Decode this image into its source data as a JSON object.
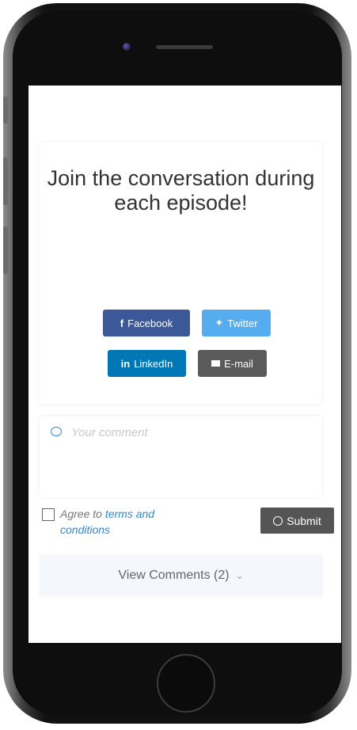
{
  "share": {
    "headline": "Join the conversation during each episode!",
    "buttons": {
      "facebook": "Facebook",
      "twitter": "Twitter",
      "linkedin": "LinkedIn",
      "email": "E-mail"
    }
  },
  "comment": {
    "placeholder": "Your comment",
    "agree_prefix": "Agree to",
    "terms_link": "terms and conditions",
    "submit_label": "Submit"
  },
  "view_comments_label": "View Comments (2)",
  "colors": {
    "facebook": "#3b5998",
    "twitter": "#55acee",
    "linkedin": "#0077b5",
    "email": "#5a5a5a",
    "submit": "#555555",
    "accent": "#2a8ad4"
  },
  "icons": {
    "facebook": "facebook-icon",
    "twitter": "twitter-icon",
    "linkedin": "linkedin-icon",
    "email": "mail-icon",
    "comment": "speech-bubble-icon",
    "submit": "check-circle-icon",
    "view_comments": "chevron-down-icon"
  }
}
